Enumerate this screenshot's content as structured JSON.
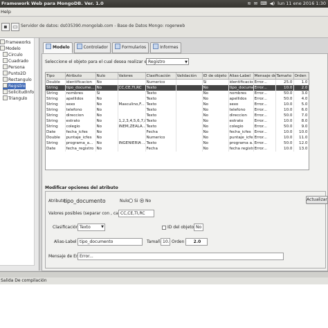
{
  "window": {
    "title": "Framework Web para MongoDB. Ver. 1.0",
    "clock": "lun 11 ene 2016 1:30"
  },
  "menu": {
    "help": "Help"
  },
  "toolbar": {
    "server_info": "Servidor de datos: ds035390.mongolab.com - Base de Datos Mongo: rogerweb"
  },
  "tree": {
    "items": [
      {
        "label": "Frameworks"
      },
      {
        "label": "Modelo"
      },
      {
        "label": "Circulo"
      },
      {
        "label": "Cuadrado"
      },
      {
        "label": "Persona"
      },
      {
        "label": "Punto2D"
      },
      {
        "label": "Rectangulo"
      },
      {
        "label": "Registro"
      },
      {
        "label": "SolicitudInformacion"
      },
      {
        "label": "Triangulo"
      }
    ],
    "selected_index": 7
  },
  "tabs": [
    {
      "label": "Modelo",
      "active": true
    },
    {
      "label": "Controlador",
      "active": false
    },
    {
      "label": "Formularios",
      "active": false
    },
    {
      "label": "Informes",
      "active": false
    }
  ],
  "form": {
    "selector_label": "Seleccione el objeto para el cual desea realizar el formulario:",
    "selector_value": "Registro"
  },
  "table": {
    "columns": [
      "Tipo",
      "Atributo",
      "Nulo",
      "Valores",
      "Clasificación",
      "Validación",
      "ID de objeto",
      "Alias-Label",
      "Mensaje de ...",
      "Tamaño",
      "Orden"
    ],
    "rows": [
      [
        "Double",
        "identificacion",
        "No",
        "",
        "Numerico",
        "",
        "Si",
        "identificacion",
        "Error...",
        "25.0",
        "1.0"
      ],
      [
        "String",
        "tipo_docume...",
        "No",
        "CC,CE,TI,RC",
        "Texto",
        "",
        "No",
        "tipo_docume...",
        "Error...",
        "10.0",
        "2.0"
      ],
      [
        "String",
        "nombres",
        "Si",
        "",
        "Texto",
        "",
        "No",
        "nombres",
        "Error...",
        "50.0",
        "3.0"
      ],
      [
        "String",
        "apellidos",
        "No",
        "",
        "Texto",
        "",
        "No",
        "apellidos",
        "Error...",
        "50.0",
        "4.0"
      ],
      [
        "String",
        "sexo",
        "No",
        "Masculino,F...",
        "Texto",
        "",
        "No",
        "sexo",
        "Error...",
        "10.0",
        "5.0"
      ],
      [
        "String",
        "telefono",
        "No",
        "",
        "Texto",
        "",
        "No",
        "telefono",
        "Error...",
        "10.0",
        "6.0"
      ],
      [
        "String",
        "direccion",
        "No",
        "",
        "Texto",
        "",
        "No",
        "direccion",
        "Error...",
        "50.0",
        "7.0"
      ],
      [
        "String",
        "estrato",
        "No",
        "1,2,3,4,5,6,7,8",
        "Texto",
        "",
        "No",
        "estrato",
        "Error...",
        "10.0",
        "8.0"
      ],
      [
        "String",
        "colegio",
        "No",
        "INEM,ZEALA...",
        "Texto",
        "",
        "No",
        "colegio",
        "Error...",
        "50.0",
        "9.0"
      ],
      [
        "Date",
        "fecha_icfes",
        "No",
        "",
        "Fecha",
        "",
        "No",
        "fecha_icfes",
        "Error...",
        "10.0",
        "10.0"
      ],
      [
        "Double",
        "puntaje_icfes",
        "No",
        "",
        "Numerico",
        "",
        "No",
        "puntaje_icfes",
        "Error...",
        "10.0",
        "11.0"
      ],
      [
        "String",
        "programa_a...",
        "No",
        "INGENIERIA ...",
        "Texto",
        "",
        "No",
        "programa a...",
        "Error...",
        "50.0",
        "12.0"
      ],
      [
        "Date",
        "fecha_registro",
        "No",
        "",
        "Fecha",
        "",
        "No",
        "fecha registro",
        "Error...",
        "10.0",
        "13.0"
      ]
    ],
    "selected_row": 1
  },
  "edit": {
    "title": "Modificar opciones del atributo",
    "attribute_label": "Atributo:",
    "attribute_name": "tipo_documento",
    "null_label": "Nulo",
    "null_si": "Si",
    "null_no": "No",
    "null_value": "No",
    "update_button": "Actualizar",
    "values_label": "Valores posibles (separar con , cada valor)",
    "values_value": "CC,CE,TI,RC",
    "classification_label": "Clasificación",
    "classification_value": "Texto",
    "object_id_label": "ID del objeto",
    "object_id_value": "No",
    "alias_label": "Alias-Label",
    "alias_value": "tipo_documento",
    "size_label": "Tamaño",
    "size_value": "10.0",
    "order_label": "Orden",
    "order_value": "2.0",
    "error_label": "Mensaje de Error",
    "error_value": "Error..."
  },
  "console": {
    "tab_label": "Salida De compilación"
  }
}
